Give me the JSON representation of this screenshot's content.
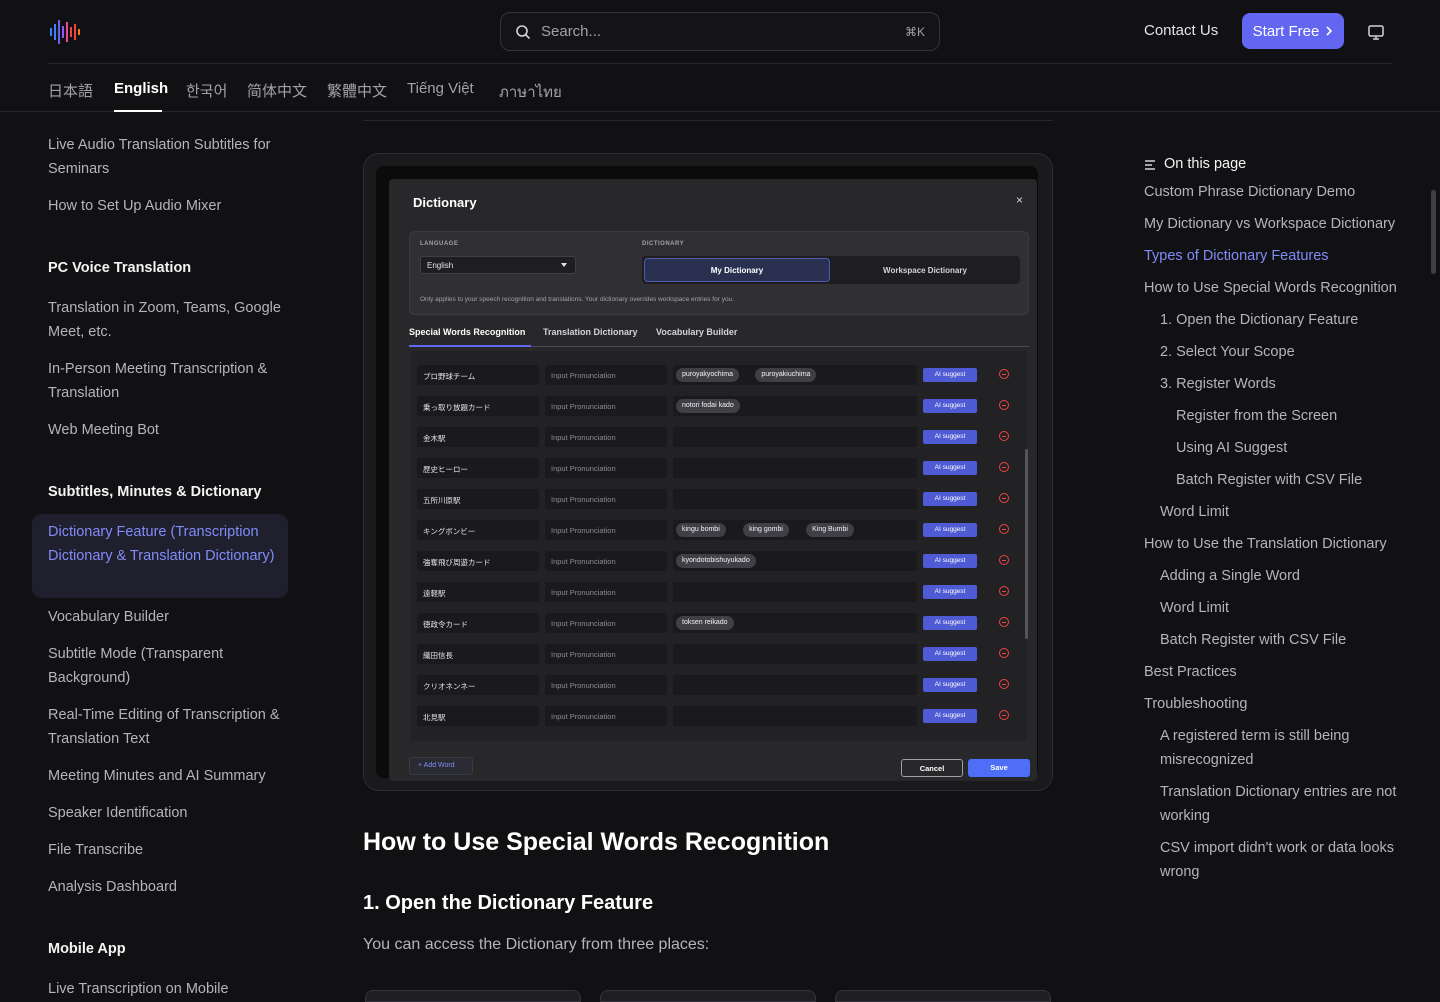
{
  "header": {
    "search_placeholder": "Search...",
    "search_shortcut": "⌘K",
    "contact": "Contact Us",
    "start": "Start Free"
  },
  "languages": [
    "日本語",
    "English",
    "한국어",
    "简体中文",
    "繁體中文",
    "Tiếng Việt",
    "ภาษาไทย"
  ],
  "active_language": "English",
  "sidebar": {
    "items_top": [
      "Live Audio Translation Subtitles for Seminars",
      "How to Set Up Audio Mixer"
    ],
    "section_pc": "PC Voice Translation",
    "items_pc": [
      "Translation in Zoom, Teams, Google Meet, etc.",
      "In-Person Meeting Transcription & Translation",
      "Web Meeting Bot"
    ],
    "section_subtitles": "Subtitles, Minutes & Dictionary",
    "active_item": "Dictionary Feature (Transcription Dictionary & Translation Dictionary)",
    "items_sub": [
      "Vocabulary Builder",
      "Subtitle Mode (Transparent Background)",
      "Real-Time Editing of Transcription & Translation Text",
      "Meeting Minutes and AI Summary",
      "Speaker Identification",
      "File Transcribe",
      "Analysis Dashboard"
    ],
    "section_mobile": "Mobile App",
    "items_mobile": [
      "Live Transcription on Mobile"
    ]
  },
  "dialog": {
    "title": "Dictionary",
    "close": "×",
    "language_label": "LANGUAGE",
    "language_value": "English",
    "dictionary_label": "DICTIONARY",
    "my_dictionary": "My Dictionary",
    "workspace_dictionary": "Workspace Dictionary",
    "note": "Only applies to your speech recognition and translations. Your dictionary overrides workspace entries for you.",
    "tabs": [
      "Special Words Recognition",
      "Translation Dictionary",
      "Vocabulary Builder"
    ],
    "pron_placeholder": "Input Pronunciation",
    "ai_label": "AI suggest",
    "rows": [
      {
        "term": "プロ野球チーム",
        "chips": [
          "puroyakyochima",
          "puroyakiuchima"
        ]
      },
      {
        "term": "乗っ取り放題カード",
        "chips": [
          "notori fodai kado"
        ]
      },
      {
        "term": "金木駅",
        "chips": []
      },
      {
        "term": "歴史ヒーロー",
        "chips": []
      },
      {
        "term": "五所川原駅",
        "chips": []
      },
      {
        "term": "キングボンビー",
        "chips": [
          "kingu bombi",
          "king gombi",
          "King Bumbi"
        ]
      },
      {
        "term": "強奪飛び周遊カード",
        "chips": [
          "kyondotobishuyukado"
        ]
      },
      {
        "term": "遠軽駅",
        "chips": []
      },
      {
        "term": "徳政令カード",
        "chips": [
          "toksen reikado"
        ]
      },
      {
        "term": "織田信長",
        "chips": []
      },
      {
        "term": "クリオネンネー",
        "chips": []
      },
      {
        "term": "北見駅",
        "chips": []
      }
    ],
    "add_word": "+ Add Word",
    "cancel": "Cancel",
    "save": "Save"
  },
  "content": {
    "h2": "How to Use Special Words Recognition",
    "h3": "1. Open the Dictionary Feature",
    "paragraph": "You can access the Dictionary from three places:"
  },
  "toc": {
    "heading": "On this page",
    "items": [
      {
        "label": "Custom Phrase Dictionary Demo",
        "level": 0
      },
      {
        "label": "My Dictionary vs Workspace Dictionary",
        "level": 0
      },
      {
        "label": "Types of Dictionary Features",
        "level": 0,
        "active": true
      },
      {
        "label": "How to Use Special Words Recognition",
        "level": 0
      },
      {
        "label": "1. Open the Dictionary Feature",
        "level": 1
      },
      {
        "label": "2. Select Your Scope",
        "level": 1
      },
      {
        "label": "3. Register Words",
        "level": 1
      },
      {
        "label": "Register from the Screen",
        "level": 2
      },
      {
        "label": "Using AI Suggest",
        "level": 2
      },
      {
        "label": "Batch Register with CSV File",
        "level": 2
      },
      {
        "label": "Word Limit",
        "level": 1
      },
      {
        "label": "How to Use the Translation Dictionary",
        "level": 0
      },
      {
        "label": "Adding a Single Word",
        "level": 1
      },
      {
        "label": "Word Limit",
        "level": 1
      },
      {
        "label": "Batch Register with CSV File",
        "level": 1
      },
      {
        "label": "Best Practices",
        "level": 0
      },
      {
        "label": "Troubleshooting",
        "level": 0
      },
      {
        "label": "A registered term is still being misrecognized",
        "level": 1
      },
      {
        "label": "Translation Dictionary entries are not working",
        "level": 1
      },
      {
        "label": "CSV import didn't work or data looks wrong",
        "level": 1
      }
    ]
  },
  "colors": {
    "accent": "#6366f1",
    "active_link": "#818cf8",
    "background": "#111113"
  }
}
